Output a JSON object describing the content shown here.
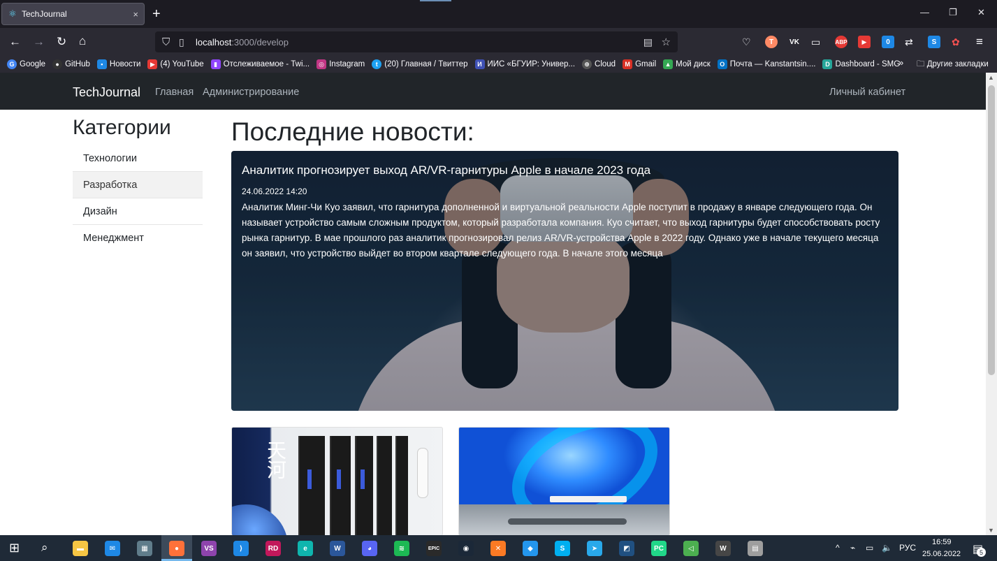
{
  "browser": {
    "tab_title": "TechJournal",
    "tab_close": "×",
    "new_tab": "+",
    "url_host": "localhost",
    "url_path": ":3000/develop",
    "window_controls": [
      "—",
      "❐",
      "✕"
    ],
    "extensions": [
      {
        "label": "T",
        "color": "#ff8a65"
      },
      {
        "label": "VK",
        "color": "#2b2a33"
      },
      {
        "label": "ABP",
        "color": "#e53935"
      },
      {
        "label": "▶",
        "color": "#e53935"
      },
      {
        "label": "0",
        "color": "#1e88e5"
      },
      {
        "label": "S",
        "color": "#1e88e5"
      }
    ],
    "bookmarks": [
      {
        "label": "Google",
        "icon": "G",
        "color": "#4285f4"
      },
      {
        "label": "GitHub",
        "icon": "●",
        "color": "#333333"
      },
      {
        "label": "Новости",
        "icon": "▪",
        "color": "#1e88e5"
      },
      {
        "label": "(4) YouTube",
        "icon": "▶",
        "color": "#e53935"
      },
      {
        "label": "Отслеживаемое - Twi...",
        "icon": "▮",
        "color": "#9146ff"
      },
      {
        "label": "Instagram",
        "icon": "◎",
        "color": "#c13584"
      },
      {
        "label": "(20) Главная / Твиттер",
        "icon": "t",
        "color": "#1da1f2"
      },
      {
        "label": "ИИС «БГУИР: Универ...",
        "icon": "И",
        "color": "#3f51b5"
      },
      {
        "label": "Cloud",
        "icon": "⊕",
        "color": "#555555"
      },
      {
        "label": "Gmail",
        "icon": "M",
        "color": "#d93025"
      },
      {
        "label": "Мой диск",
        "icon": "▲",
        "color": "#34a853"
      },
      {
        "label": "Почта — Kanstantsin....",
        "icon": "O",
        "color": "#0072c6"
      },
      {
        "label": "Dashboard - SMG",
        "icon": "D",
        "color": "#26a69a"
      }
    ],
    "bookmarks_more": "»",
    "other_bookmarks": "Другие закладки"
  },
  "site": {
    "brand": "TechJournal",
    "nav": [
      "Главная",
      "Администрирование"
    ],
    "account": "Личный кабинет"
  },
  "sidebar": {
    "title": "Категории",
    "items": [
      "Технологии",
      "Разработка",
      "Дизайн",
      "Менеджмент"
    ],
    "active_index": 1
  },
  "main": {
    "title": "Последние новости:",
    "featured": {
      "title": "Аналитик прогнозирует выход AR/VR-гарнитуры Apple в начале 2023 года",
      "date": "24.06.2022 14:20",
      "text": "Аналитик Минг-Чи Куо заявил, что гарнитура дополненной и виртуальной реальности Apple поступит в продажу в январе следующего года. Он называет устройство самым сложным продуктом, который разработала компания. Куо считает, что выход гарнитуры будет способствовать росту рынка гарнитур.  В мае прошлого раз аналитик прогнозировал релиз AR/VR-устройства Apple в 2022 году. Однако уже в начале текущего месяца он заявил, что устройство выйдет во втором квартале следующего года.  В начале этого месяца"
    },
    "card1_sign": "天河"
  },
  "taskbar": {
    "icons": [
      {
        "name": "file-explorer",
        "color": "#f6c644",
        "label": "▬"
      },
      {
        "name": "mail",
        "color": "#1e88e5",
        "label": "✉"
      },
      {
        "name": "calculator",
        "color": "#607d8b",
        "label": "▦"
      },
      {
        "name": "firefox",
        "color": "#ff7139",
        "label": "●"
      },
      {
        "name": "visual-studio",
        "color": "#8e44ad",
        "label": "VS"
      },
      {
        "name": "vscode",
        "color": "#1e88e5",
        "label": "⟩"
      },
      {
        "name": "rider",
        "color": "#c2185b",
        "label": "RD"
      },
      {
        "name": "edge",
        "color": "#0fb5ae",
        "label": "e"
      },
      {
        "name": "word",
        "color": "#2b579a",
        "label": "W"
      },
      {
        "name": "discord",
        "color": "#5865f2",
        "label": "◕"
      },
      {
        "name": "spotify",
        "color": "#1db954",
        "label": "≋"
      },
      {
        "name": "epic-games",
        "color": "#2a2a2a",
        "label": "EPIC"
      },
      {
        "name": "steam",
        "color": "#1b2838",
        "label": "◉"
      },
      {
        "name": "xampp",
        "color": "#fb7a24",
        "label": "✕"
      },
      {
        "name": "docker",
        "color": "#2496ed",
        "label": "◆"
      },
      {
        "name": "skype",
        "color": "#00aff0",
        "label": "S"
      },
      {
        "name": "telegram",
        "color": "#29a9eb",
        "label": "➤"
      },
      {
        "name": "sourcetree",
        "color": "#205081",
        "label": "◩"
      },
      {
        "name": "pycharm",
        "color": "#21d789",
        "label": "PC"
      },
      {
        "name": "vpn",
        "color": "#4caf50",
        "label": "◁"
      },
      {
        "name": "wordpress",
        "color": "#464646",
        "label": "W"
      },
      {
        "name": "db-tool",
        "color": "#9e9e9e",
        "label": "▤"
      }
    ],
    "tray_lang": "РУС",
    "time": "16:59",
    "date": "25.06.2022",
    "notifications": "5"
  }
}
